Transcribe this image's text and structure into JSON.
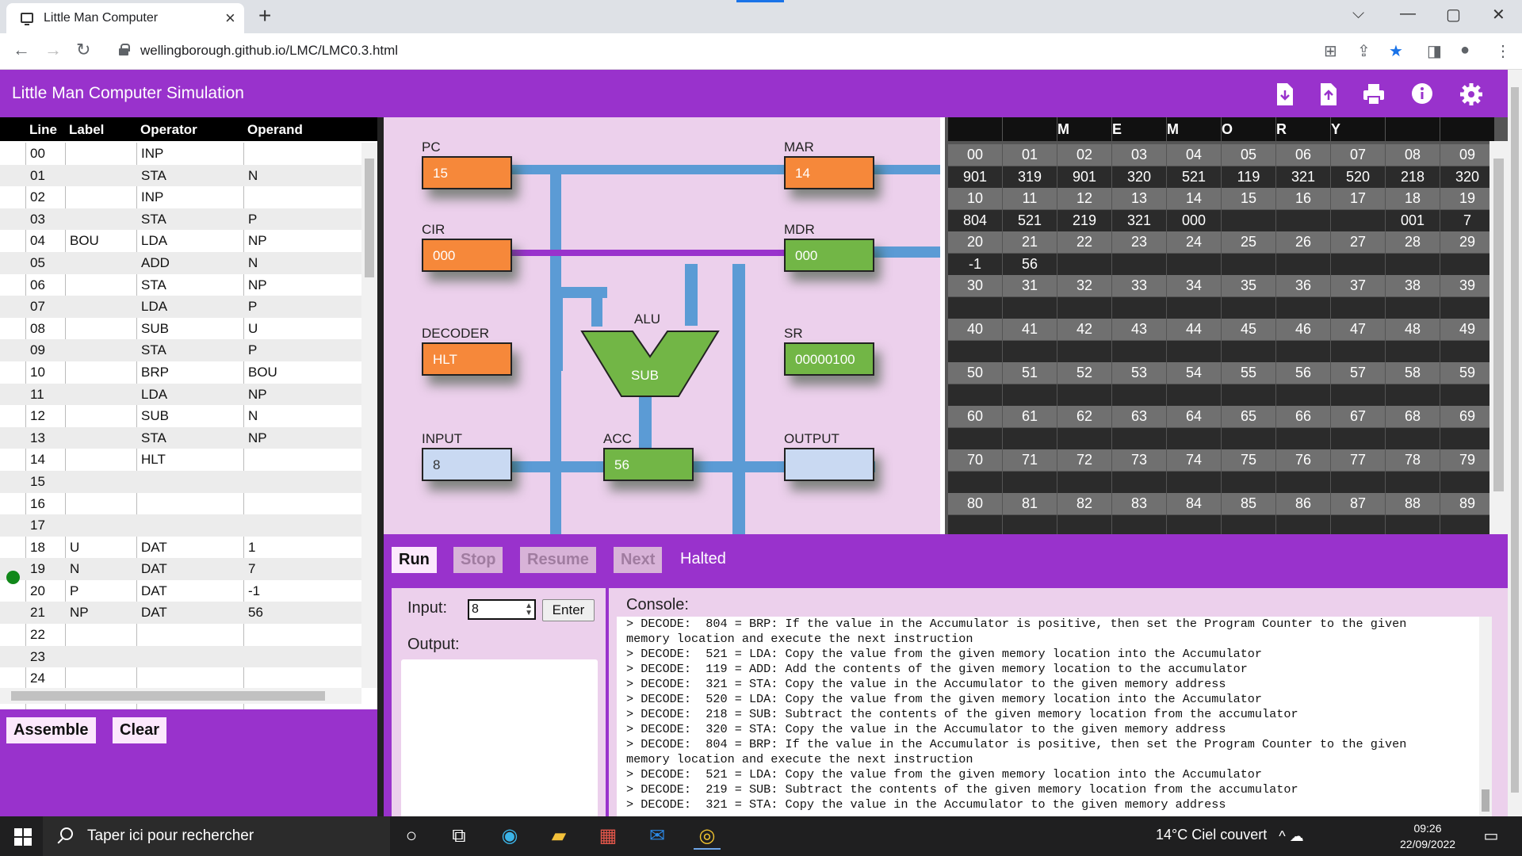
{
  "browser": {
    "tab_title": "Little Man Computer",
    "url": "wellingborough.github.io/LMC/LMC0.3.html"
  },
  "app": {
    "title": "Little Man Computer Simulation",
    "header_icons": [
      "download-icon",
      "upload-icon",
      "print-icon",
      "info-icon",
      "settings-icon"
    ]
  },
  "program": {
    "headers": {
      "line": "Line",
      "label": "Label",
      "operator": "Operator",
      "operand": "Operand"
    },
    "rows": [
      {
        "line": "00",
        "label": "",
        "op": "INP",
        "operand": ""
      },
      {
        "line": "01",
        "label": "",
        "op": "STA",
        "operand": "N"
      },
      {
        "line": "02",
        "label": "",
        "op": "INP",
        "operand": ""
      },
      {
        "line": "03",
        "label": "",
        "op": "STA",
        "operand": "P"
      },
      {
        "line": "04",
        "label": "BOU",
        "op": "LDA",
        "operand": "NP"
      },
      {
        "line": "05",
        "label": "",
        "op": "ADD",
        "operand": "N"
      },
      {
        "line": "06",
        "label": "",
        "op": "STA",
        "operand": "NP"
      },
      {
        "line": "07",
        "label": "",
        "op": "LDA",
        "operand": "P"
      },
      {
        "line": "08",
        "label": "",
        "op": "SUB",
        "operand": "U"
      },
      {
        "line": "09",
        "label": "",
        "op": "STA",
        "operand": "P"
      },
      {
        "line": "10",
        "label": "",
        "op": "BRP",
        "operand": "BOU"
      },
      {
        "line": "11",
        "label": "",
        "op": "LDA",
        "operand": "NP"
      },
      {
        "line": "12",
        "label": "",
        "op": "SUB",
        "operand": "N"
      },
      {
        "line": "13",
        "label": "",
        "op": "STA",
        "operand": "NP"
      },
      {
        "line": "14",
        "label": "",
        "op": "HLT",
        "operand": ""
      },
      {
        "line": "15",
        "label": "",
        "op": "",
        "operand": ""
      },
      {
        "line": "16",
        "label": "",
        "op": "",
        "operand": ""
      },
      {
        "line": "17",
        "label": "",
        "op": "",
        "operand": ""
      },
      {
        "line": "18",
        "label": "U",
        "op": "DAT",
        "operand": "1"
      },
      {
        "line": "19",
        "label": "N",
        "op": "DAT",
        "operand": "7"
      },
      {
        "line": "20",
        "label": "P",
        "op": "DAT",
        "operand": "-1"
      },
      {
        "line": "21",
        "label": "NP",
        "op": "DAT",
        "operand": "56"
      },
      {
        "line": "22",
        "label": "",
        "op": "",
        "operand": ""
      },
      {
        "line": "23",
        "label": "",
        "op": "",
        "operand": ""
      },
      {
        "line": "24",
        "label": "",
        "op": "",
        "operand": ""
      }
    ],
    "breakpoint_line": "14",
    "assemble_label": "Assemble",
    "clear_label": "Clear"
  },
  "cpu": {
    "pc": {
      "label": "PC",
      "value": "15"
    },
    "mar": {
      "label": "MAR",
      "value": "14"
    },
    "cir": {
      "label": "CIR",
      "value": "000"
    },
    "mdr": {
      "label": "MDR",
      "value": "000"
    },
    "decoder": {
      "label": "DECODER",
      "value": "HLT"
    },
    "alu": {
      "label": "ALU",
      "value": "SUB"
    },
    "sr": {
      "label": "SR",
      "value": "00000100"
    },
    "input": {
      "label": "INPUT",
      "value": "8"
    },
    "acc": {
      "label": "ACC",
      "value": "56"
    },
    "output": {
      "label": "OUTPUT",
      "value": ""
    }
  },
  "memory": {
    "title_letters": [
      "M",
      "E",
      "M",
      "O",
      "R",
      "Y"
    ],
    "rows": [
      {
        "addrs": [
          "00",
          "01",
          "02",
          "03",
          "04",
          "05",
          "06",
          "07",
          "08",
          "09"
        ],
        "values": [
          "901",
          "319",
          "901",
          "320",
          "521",
          "119",
          "321",
          "520",
          "218",
          "320"
        ]
      },
      {
        "addrs": [
          "10",
          "11",
          "12",
          "13",
          "14",
          "15",
          "16",
          "17",
          "18",
          "19"
        ],
        "values": [
          "804",
          "521",
          "219",
          "321",
          "000",
          "",
          "",
          "",
          "001",
          "7"
        ]
      },
      {
        "addrs": [
          "20",
          "21",
          "22",
          "23",
          "24",
          "25",
          "26",
          "27",
          "28",
          "29"
        ],
        "values": [
          "-1",
          "56",
          "",
          "",
          "",
          "",
          "",
          "",
          "",
          ""
        ]
      },
      {
        "addrs": [
          "30",
          "31",
          "32",
          "33",
          "34",
          "35",
          "36",
          "37",
          "38",
          "39"
        ],
        "values": [
          "",
          "",
          "",
          "",
          "",
          "",
          "",
          "",
          "",
          ""
        ]
      },
      {
        "addrs": [
          "40",
          "41",
          "42",
          "43",
          "44",
          "45",
          "46",
          "47",
          "48",
          "49"
        ],
        "values": [
          "",
          "",
          "",
          "",
          "",
          "",
          "",
          "",
          "",
          ""
        ]
      },
      {
        "addrs": [
          "50",
          "51",
          "52",
          "53",
          "54",
          "55",
          "56",
          "57",
          "58",
          "59"
        ],
        "values": [
          "",
          "",
          "",
          "",
          "",
          "",
          "",
          "",
          "",
          ""
        ]
      },
      {
        "addrs": [
          "60",
          "61",
          "62",
          "63",
          "64",
          "65",
          "66",
          "67",
          "68",
          "69"
        ],
        "values": [
          "",
          "",
          "",
          "",
          "",
          "",
          "",
          "",
          "",
          ""
        ]
      },
      {
        "addrs": [
          "70",
          "71",
          "72",
          "73",
          "74",
          "75",
          "76",
          "77",
          "78",
          "79"
        ],
        "values": [
          "",
          "",
          "",
          "",
          "",
          "",
          "",
          "",
          "",
          ""
        ]
      },
      {
        "addrs": [
          "80",
          "81",
          "82",
          "83",
          "84",
          "85",
          "86",
          "87",
          "88",
          "89"
        ],
        "values": [
          "",
          "",
          "",
          "",
          "",
          "",
          "",
          "",
          "",
          ""
        ]
      }
    ]
  },
  "controls": {
    "run": "Run",
    "stop": "Stop",
    "resume": "Resume",
    "next": "Next",
    "status": "Halted"
  },
  "io": {
    "input_label": "Input:",
    "input_value": "8",
    "enter_label": "Enter",
    "output_label": "Output:"
  },
  "console": {
    "label": "Console:",
    "lines": [
      "> DECODE:  804 = BRP: If the value in the Accumulator is positive, then set the Program Counter to the given",
      "memory location and execute the next instruction",
      "> DECODE:  521 = LDA: Copy the value from the given memory location into the Accumulator",
      "> DECODE:  119 = ADD: Add the contents of the given memory location to the accumulator",
      "> DECODE:  321 = STA: Copy the value in the Accumulator to the given memory address",
      "> DECODE:  520 = LDA: Copy the value from the given memory location into the Accumulator",
      "> DECODE:  218 = SUB: Subtract the contents of the given memory location from the accumulator",
      "> DECODE:  320 = STA: Copy the value in the Accumulator to the given memory address",
      "> DECODE:  804 = BRP: If the value in the Accumulator is positive, then set the Program Counter to the given",
      "memory location and execute the next instruction",
      "> DECODE:  521 = LDA: Copy the value from the given memory location into the Accumulator",
      "> DECODE:  219 = SUB: Subtract the contents of the given memory location from the accumulator",
      "> DECODE:  321 = STA: Copy the value in the Accumulator to the given memory address"
    ]
  },
  "taskbar": {
    "search_placeholder": "Taper ici pour rechercher",
    "weather": "14°C  Ciel couvert",
    "time": "09:26",
    "date": "22/09/2022"
  },
  "colors": {
    "app_purple": "#9932cc",
    "panel_pink": "#ecd0ec",
    "register_orange": "#f6883a",
    "register_green": "#72b646",
    "register_blue": "#c9d9f2",
    "bus_blue": "#5b9bd5",
    "bus_purple": "#9932cc"
  }
}
